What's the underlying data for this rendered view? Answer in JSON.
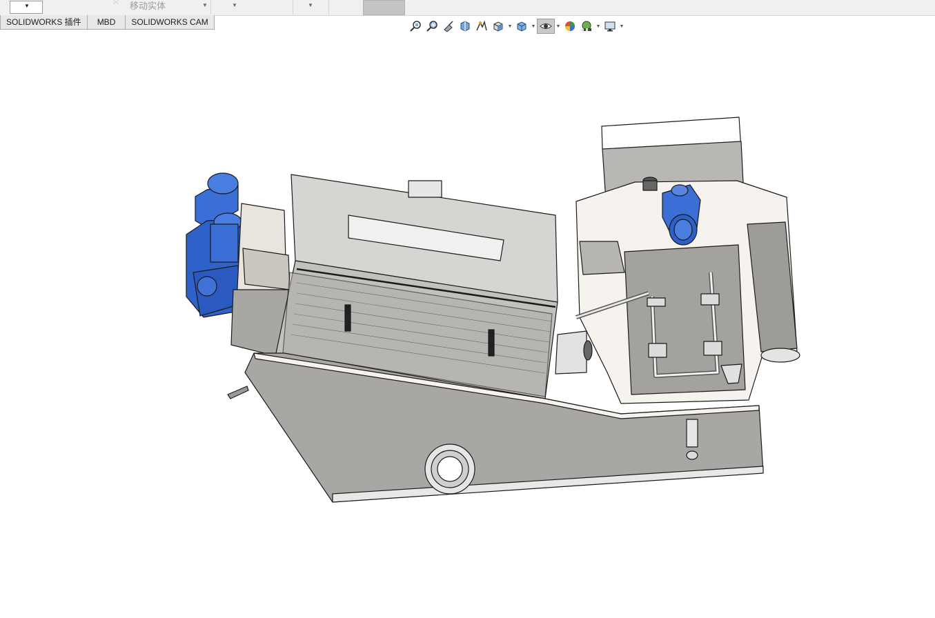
{
  "toolbar": {
    "move_body_label": "移动实体",
    "combo_value": ""
  },
  "tabs": [
    {
      "label": "SOLIDWORKS 插件"
    },
    {
      "label": "MBD"
    },
    {
      "label": "SOLIDWORKS CAM"
    }
  ],
  "heads_up_view_toolbar": {
    "icons": [
      "zoom-to-fit-icon",
      "zoom-to-area-icon",
      "previous-view-icon",
      "section-view-icon",
      "dynamic-annotation-views-icon",
      "view-orientation-icon",
      "display-style-icon",
      "hide-show-items-icon",
      "edit-appearance-icon",
      "apply-scene-icon",
      "view-settings-icon"
    ]
  },
  "model": {
    "name": "screw press sludge dewatering machine assembly",
    "colors": {
      "motor": "#3b6fd6",
      "body": "#a7a5a1",
      "panel": "#c9c7c3",
      "light": "#f5f1ec",
      "edge": "#1a1a1a"
    }
  }
}
